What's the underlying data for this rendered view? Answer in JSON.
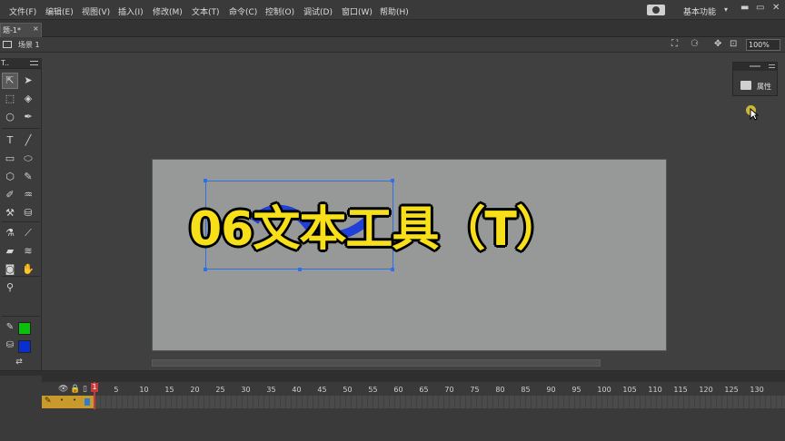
{
  "menu": {
    "items": [
      "文件(F)",
      "编辑(E)",
      "视图(V)",
      "插入(I)",
      "修改(M)",
      "文本(T)",
      "命令(C)",
      "控制(O)",
      "调试(D)",
      "窗口(W)",
      "帮助(H)"
    ]
  },
  "workspace": {
    "label": "基本功能"
  },
  "window_controls": {
    "minimize": "▬",
    "restore": "▭",
    "close": "✕"
  },
  "document": {
    "tab_label": "题-1*",
    "tab_close": "×"
  },
  "editbar": {
    "scene_label": "场景 1",
    "zoom": "100%"
  },
  "tools": {
    "title": "T..",
    "items": [
      {
        "name": "selection-tool-icon",
        "glyph": "⇱",
        "selected": true
      },
      {
        "name": "subselection-tool-icon",
        "glyph": "➤"
      },
      {
        "name": "free-transform-tool-icon",
        "glyph": "⬚"
      },
      {
        "name": "3d-rotation-tool-icon",
        "glyph": "◈"
      },
      {
        "name": "lasso-tool-icon",
        "glyph": "○"
      },
      {
        "name": "pen-tool-icon",
        "glyph": "✒"
      },
      {
        "name": "text-tool-icon",
        "glyph": "T"
      },
      {
        "name": "line-tool-icon",
        "glyph": "╱"
      },
      {
        "name": "rectangle-tool-icon",
        "glyph": "▭"
      },
      {
        "name": "oval-tool-icon",
        "glyph": "⬭"
      },
      {
        "name": "polystar-tool-icon",
        "glyph": "⬡"
      },
      {
        "name": "pencil-tool-icon",
        "glyph": "✎"
      },
      {
        "name": "brush-tool-icon",
        "glyph": "✐"
      },
      {
        "name": "deco-tool-icon",
        "glyph": "♒"
      },
      {
        "name": "bone-tool-icon",
        "glyph": "⚒"
      },
      {
        "name": "paint-bucket-tool-icon",
        "glyph": "⛁"
      },
      {
        "name": "ink-bottle-tool-icon",
        "glyph": "⚗"
      },
      {
        "name": "eyedropper-tool-icon",
        "glyph": "⟋"
      },
      {
        "name": "eraser-tool-icon",
        "glyph": "▰"
      },
      {
        "name": "width-tool-icon",
        "glyph": "≋"
      },
      {
        "name": "camera-tool-icon",
        "glyph": "◙"
      },
      {
        "name": "hand-tool-icon",
        "glyph": "✋"
      },
      {
        "name": "zoom-tool-icon",
        "glyph": "⚲"
      }
    ],
    "stroke_color": "#0ac00a",
    "fill_color": "#0a2fd0"
  },
  "properties_panel": {
    "label": "属性"
  },
  "overlay": {
    "title": "06文本工具（T）"
  },
  "timeline": {
    "ruler": [
      1,
      5,
      10,
      15,
      20,
      25,
      30,
      35,
      40,
      45,
      50,
      55,
      60,
      65,
      70,
      75,
      80,
      85,
      90,
      95,
      100,
      105,
      110,
      115,
      120,
      125,
      130
    ],
    "current_frame": "1"
  },
  "colors": {
    "overlay_text": "#f7e01a",
    "selection_box": "#2f6fe8",
    "stage": "#979998",
    "layer_highlight": "#c79a2b",
    "playhead": "#c83a3a"
  }
}
